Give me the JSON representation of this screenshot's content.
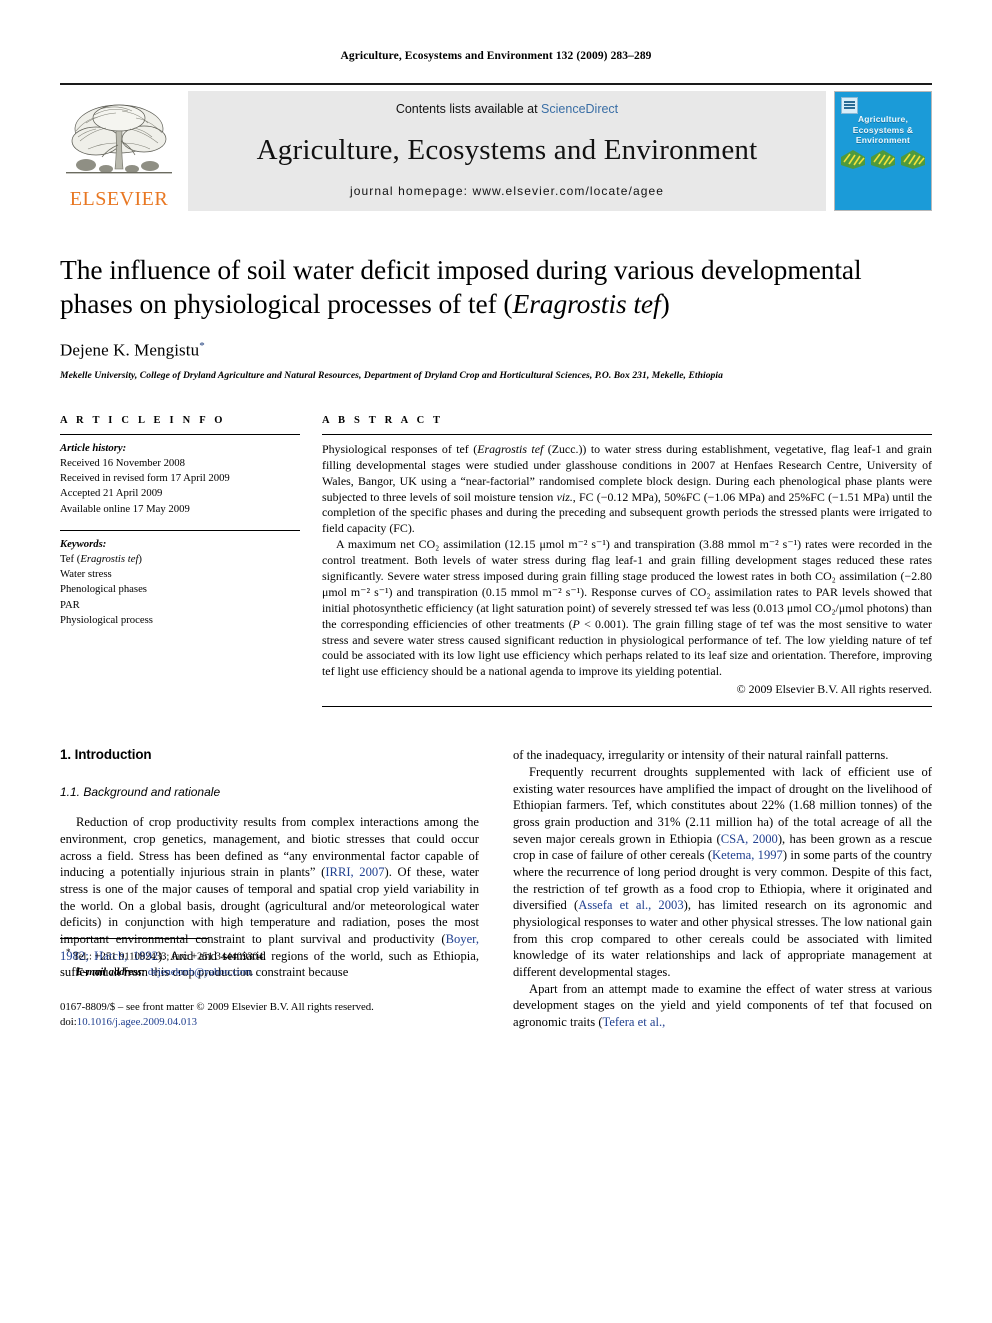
{
  "running_head": "Agriculture, Ecosystems and Environment 132 (2009) 283–289",
  "masthead": {
    "contents_prefix": "Contents lists available at ",
    "science_direct": "ScienceDirect",
    "journal_title": "Agriculture, Ecosystems and Environment",
    "homepage": "journal homepage: www.elsevier.com/locate/agee",
    "publisher_wordmark": "ELSEVIER",
    "publisher_color": "#E87722",
    "science_direct_color": "#3a6ea5",
    "cover": {
      "title_line1": "Agriculture,",
      "title_line2": "Ecosystems &",
      "title_line3": "Environment",
      "background_color": "#1b9bd8"
    }
  },
  "title": {
    "line1": "The influence of soil water deficit imposed during various developmental",
    "line2_prefix": "phases on physiological processes of tef (",
    "line2_italic": "Eragrostis tef",
    "line2_suffix": ")"
  },
  "author": {
    "name": "Dejene K. Mengistu",
    "corresponding_marker": "*",
    "affiliation": "Mekelle University, College of Dryland Agriculture and Natural Resources, Department of Dryland Crop and Horticultural Sciences, P.O. Box 231, Mekelle, Ethiopia"
  },
  "article_info": {
    "heading": "A R T I C L E  I N F O",
    "history_label": "Article history:",
    "history": [
      "Received 16 November 2008",
      "Received in revised form 17 April 2009",
      "Accepted 21 April 2009",
      "Available online 17 May 2009"
    ],
    "keywords_label": "Keywords:",
    "keywords_first_prefix": "Tef (",
    "keywords_first_italic": "Eragrostis tef",
    "keywords_first_suffix": ")",
    "keywords": [
      "Water stress",
      "Phenological phases",
      "PAR",
      "Physiological process"
    ]
  },
  "abstract": {
    "heading": "A B S T R A C T",
    "p1_a": "Physiological responses of tef (",
    "p1_italic": "Eragrostis tef",
    "p1_b": " (Zucc.)) to water stress during establishment, vegetative, flag leaf-1 and grain filling developmental stages were studied under glasshouse conditions in 2007 at Henfaes Research Centre, University of Wales, Bangor, UK using a “near-factorial” randomised complete block design. During each phenological phase plants were subjected to three levels of soil moisture tension ",
    "p1_viz_italic": "viz.",
    "p1_c": ", FC (−0.12 MPa), 50%FC (−1.06 MPa) and 25%FC (−1.51 MPa) until the completion of the specific phases and during the preceding and subsequent growth periods the stressed plants were irrigated to field capacity (FC).",
    "p2_a": "A maximum net CO₂ assimilation (12.15 μmol m⁻² s⁻¹) and transpiration (3.88 mmol m⁻² s⁻¹) rates were recorded in the control treatment. Both levels of water stress during flag leaf-1 and grain filling development stages reduced these rates significantly. Severe water stress imposed during grain filling stage produced the lowest rates in both CO₂ assimilation (−2.80 μmol m⁻² s⁻¹) and transpiration (0.15 mmol m⁻² s⁻¹). Response curves of CO₂ assimilation rates to PAR levels showed that initial photosynthetic efficiency (at light saturation point) of severely stressed tef was less (0.013 μmol CO₂/μmol photons) than the corresponding efficiencies of other treatments (",
    "p2_p_italic": "P",
    "p2_b": " < 0.001). The grain filling stage of tef was the most sensitive to water stress and severe water stress caused significant reduction in physiological performance of tef. The low yielding nature of tef could be associated with its low light use efficiency which perhaps related to its leaf size and orientation. Therefore, improving tef light use efficiency should be a national agenda to improve its yielding potential.",
    "copyright": "© 2009 Elsevier B.V. All rights reserved."
  },
  "body": {
    "section_heading": "1. Introduction",
    "subsection_heading": "1.1. Background and rationale",
    "left_p1_a": "Reduction of crop productivity results from complex interactions among the environment, crop genetics, management, and biotic stresses that could occur across a field. Stress has been defined as “any environmental factor capable of inducing a potentially injurious strain in plants” (",
    "left_p1_cite1": "IRRI, 2007",
    "left_p1_b": "). Of these, water stress is one of the major causes of temporal and spatial crop yield variability in the world. On a global basis, drought (agricultural and/or meteorological water deficits) in conjunction with high temperature and radiation, poses the most important environmental constraint to plant survival and productivity (",
    "left_p1_cite2": "Boyer, 1982;",
    "left_p1_cite3": "Hatch, 1992",
    "left_p1_c": "). Arid and semiarid regions of the world, such as Ethiopia, suffer much from this crop production constraint because",
    "right_p1": "of the inadequacy, irregularity or intensity of their natural rainfall patterns.",
    "right_p2_a": "Frequently recurrent droughts supplemented with lack of efficient use of existing water resources have amplified the impact of drought on the livelihood of Ethiopian farmers. Tef, which constitutes about 22% (1.68 million tonnes) of the gross grain production and 31% (2.11 million ha) of the total acreage of all the seven major cereals grown in Ethiopia (",
    "right_p2_cite1": "CSA, 2000",
    "right_p2_b": "), has been grown as a rescue crop in case of failure of other cereals (",
    "right_p2_cite2": "Ketema, 1997",
    "right_p2_c": ") in some parts of the country where the recurrence of long period drought is very common. Despite of this fact, the restriction of tef growth as a food crop to Ethiopia, where it originated and diversified (",
    "right_p2_cite3": "Assefa et al., 2003",
    "right_p2_d": "), has limited research on its agronomic and physiological responses to water and other physical stresses. The low national gain from this crop compared to other cereals could be associated with limited knowledge of its water relationships and lack of appropriate management at different developmental stages.",
    "right_p3_a": "Apart from an attempt made to examine the effect of water stress at various development stages on the yield and yield components of tef that focused on agronomic traits (",
    "right_p3_cite1": "Tefera et al.,",
    "citation_color": "#1f3f8f"
  },
  "footnotes": {
    "marker": "*",
    "contact": "Tel.: +251 911082433; fax: +251 344409304.",
    "email_label": "E-mail address:",
    "email": "dejenekmh@yahoo.com.",
    "front_matter": "0167-8809/$ – see front matter © 2009 Elsevier B.V. All rights reserved.",
    "doi_label": "doi:",
    "doi": "10.1016/j.agee.2009.04.013"
  }
}
